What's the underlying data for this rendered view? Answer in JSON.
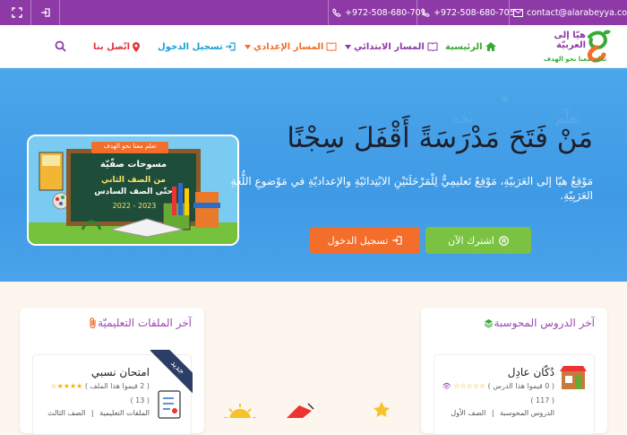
{
  "topbar": {
    "email": "contact@alarabeyya.com",
    "phone1": "+972-508-680-705",
    "phone2": "+972-508-680-701"
  },
  "nav": {
    "home": "الرئيسية",
    "primary_track": "المسار الابتدائي",
    "prep_track": "المسار الإعدادي",
    "login": "تسجيل الدخول",
    "contact": "اتّصل بنا"
  },
  "logo": {
    "name": "هيّا إلى العربيّة",
    "slogan": "تعلم معنا نحو الهدف"
  },
  "hero": {
    "title": "مَنْ فَتَحَ مَدْرَسَةً أَقْفَلَ سِجْنًا",
    "description": "مَوْقِعُ هيّا إلى العَرَبيّةِ، مَوْقِعٌ تَعليمِيٌّ لِلْمَرْحَلَتَيْنِ الابْتِدائيّةِ والإعداديّةِ في مَوْضوعِ اللُّغَةِ العَرَبِيّةِ.",
    "subscribe_button": "اشترك الآن",
    "login_button": "تسجيل الدخول",
    "board_text": {
      "top": "تعلم معنا نحو الهدف",
      "line1": "مسوحات صفّيّة",
      "line2": "من الصف الثاني",
      "line3": "حتّى الصف السادس",
      "year": "2022 - 2023"
    }
  },
  "left_panel": {
    "title": "آخر الملفات التعليميّة",
    "card": {
      "ribbon": "جديد",
      "title": "امتحان نسبي",
      "meta": "( 2 قيموا هذا الملف )",
      "count": "( 13 )",
      "tag1": "الملفات التعليمية",
      "tag2": "الصف الثالث"
    }
  },
  "right_panel": {
    "title": "آخر الدروس المحوسبة",
    "card": {
      "title": "دُكّان عادِل",
      "meta": "( 0 قيموا هذا الدرس )",
      "count": "( 117 )",
      "tag1": "الدروس المحوسبة",
      "tag2": "الصف الأول"
    }
  },
  "colors": {
    "topbar": "#8e3aa6",
    "hero": "#4ba6ea",
    "nav_green": "#3aa935",
    "nav_purple": "#8e3aa6",
    "nav_orange": "#f36d2b",
    "nav_teal": "#1b9fd8",
    "nav_red": "#e2343b",
    "subscribe": "#7cc242",
    "login": "#f36d2b"
  }
}
